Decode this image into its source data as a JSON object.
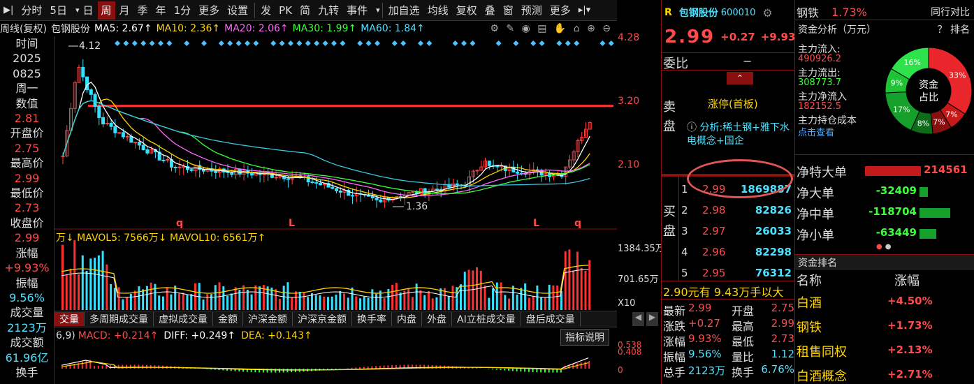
{
  "toolbar": {
    "items": [
      "分时",
      "5日",
      "日",
      "周",
      "月",
      "季",
      "年",
      "1分",
      "更多",
      "设置",
      "发",
      "PK",
      "简",
      "九转",
      "事件",
      "加自选",
      "均线",
      "复权",
      "叠",
      "窗",
      "预测",
      "更多"
    ],
    "active": "周"
  },
  "info_bar": {
    "mode": "周线(复权)",
    "name": "包钢股份",
    "ma5": "MA5: 2.67↑",
    "ma10": "MA10: 2.36↑",
    "ma20": "MA20: 2.06↑",
    "ma30": "MA30: 1.99↑",
    "ma60": "MA60: 1.84↑"
  },
  "left_panel": {
    "rows": [
      {
        "label": "时间",
        "value": "2025",
        "value2": "0825",
        "value3": "周一"
      },
      {
        "label": "数值",
        "value": "2.81"
      },
      {
        "label": "开盘价",
        "value": "2.75"
      },
      {
        "label": "最高价",
        "value": "2.99"
      },
      {
        "label": "最低价",
        "value": "2.73"
      },
      {
        "label": "收盘价",
        "value": "2.99"
      },
      {
        "label": "涨幅",
        "value": "+9.93%"
      },
      {
        "label": "振幅",
        "value": "9.56%"
      },
      {
        "label": "成交量",
        "value": "2123万"
      },
      {
        "label": "成交额",
        "value": "61.96亿"
      },
      {
        "label": "换手",
        "value": ""
      }
    ]
  },
  "price_axis": [
    "4.28",
    "3.20",
    "2.10"
  ],
  "vol_axis": [
    "1384.35万",
    "701.65万",
    "X10"
  ],
  "macd_axis": [
    "0.538",
    "0.408",
    "0"
  ],
  "annotations": {
    "high": "4.12",
    "low": "1.36",
    "markers": [
      "q",
      "L",
      "L",
      "q"
    ]
  },
  "vol_info": "万↓  MAVOL5: 7566万↓  MAVOL10: 6561万↑",
  "macd_info": {
    "head": "6,9)",
    "macd": "MACD: +0.214↑",
    "diff": "DIFF: +0.249↑",
    "dea": "DEA: +0.143↑",
    "button": "指标说明"
  },
  "indicator_tabs": [
    "交量",
    "多周期成交量",
    "虚拟成交量",
    "金额",
    "沪深金额",
    "沪深京金额",
    "换手率",
    "内盘",
    "外盘",
    "AI立桩成交量",
    "盘后成交量"
  ],
  "quote": {
    "badge": "R",
    "name": "包钢股份",
    "code": "600010",
    "price": "2.99",
    "change": "+0.27",
    "pct": "+9.93%",
    "weibi_label": "委比",
    "weibi_value": "−",
    "limit_text": "涨停(首板)",
    "analysis": "分析:稀土钢+雅下水电概念+国企",
    "sell_label": "卖盘",
    "buy_label": "买盘",
    "bids": [
      {
        "n": "1",
        "p": "2.99",
        "v": "1869887"
      },
      {
        "n": "2",
        "p": "2.98",
        "v": "82826"
      },
      {
        "n": "3",
        "p": "2.97",
        "v": "26033"
      },
      {
        "n": "4",
        "p": "2.96",
        "v": "82298"
      },
      {
        "n": "5",
        "p": "2.95",
        "v": "76312"
      }
    ],
    "summary": "2.90元有 9.43万手以大",
    "stats": [
      [
        "最新",
        "2.99",
        "开盘",
        "2.75"
      ],
      [
        "涨跌",
        "+0.27",
        "最高",
        "2.99"
      ],
      [
        "涨幅",
        "9.93%",
        "最低",
        "2.73"
      ],
      [
        "振幅",
        "9.56%",
        "量比",
        "1.12"
      ],
      [
        "总手",
        "2123万",
        "换手",
        "6.76%"
      ]
    ]
  },
  "right": {
    "sector": "钢铁",
    "sector_pct": "1.73%",
    "compare": "同行对比",
    "fund_title": "资金分析（万元）",
    "help": "？ 排名",
    "flow": [
      {
        "label": "主力流入:",
        "value": "490926.2"
      },
      {
        "label": "主力流出:",
        "value": "308773.7"
      },
      {
        "label": "主力净流入",
        "value": "182152.5"
      },
      {
        "label": "主力持仓成本",
        "value": "点击查看"
      }
    ],
    "pie_center": "资金占比",
    "pie": [
      {
        "label": "33%",
        "value": 33,
        "color": "#e8262b"
      },
      {
        "label": "7%",
        "value": 7,
        "color": "#c41a1a"
      },
      {
        "label": "7%",
        "value": 7,
        "color": "#8a1010"
      },
      {
        "label": "8%",
        "value": 8,
        "color": "#0d6b1a"
      },
      {
        "label": "17%",
        "value": 17,
        "color": "#14a02a"
      },
      {
        "label": "9%",
        "value": 9,
        "color": "#1fc435"
      },
      {
        "label": "16%",
        "value": 16,
        "color": "#2de24a"
      }
    ],
    "net": [
      {
        "label": "净特大单",
        "value": "214561",
        "dir": "up",
        "ratio": 1.0
      },
      {
        "label": "净大单",
        "value": "-32409",
        "dir": "down",
        "ratio": 0.15
      },
      {
        "label": "净中单",
        "value": "-118704",
        "dir": "down",
        "ratio": 0.55
      },
      {
        "label": "净小单",
        "value": "-63449",
        "dir": "down",
        "ratio": 0.3
      }
    ],
    "rank_title": "资金排名",
    "rank_head": [
      "名称",
      "涨幅"
    ],
    "rank": [
      {
        "name": "白酒",
        "pct": "+4.50%"
      },
      {
        "name": "钢铁",
        "pct": "+1.73%"
      },
      {
        "name": "租售同权",
        "pct": "+2.13%"
      },
      {
        "name": "白酒概念",
        "pct": "+2.71%"
      }
    ]
  }
}
